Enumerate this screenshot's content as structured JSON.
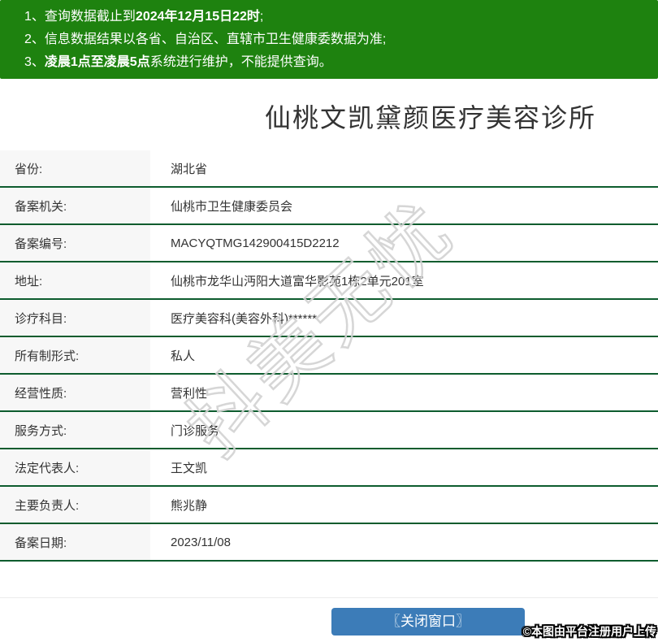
{
  "colors": {
    "banner_green": "#1e820f",
    "divider_green": "#0d5c2e",
    "button_blue": "#3c7cb8",
    "label_background": "#f7f7f7"
  },
  "banner": {
    "notices": [
      {
        "num": "1、",
        "pre": "查询数据截止到",
        "bold": "2024年12月15日22时",
        "post": ";"
      },
      {
        "num": "2、",
        "pre": "信息数据结果以各省、自治区、直辖市卫生健康委数据为准;",
        "bold": "",
        "post": ""
      },
      {
        "num": "3、",
        "pre": "",
        "bold": "凌晨1点至凌晨5点",
        "post": "系统进行维护，不能提供查询。"
      }
    ]
  },
  "title": "仙桃文凯黛颜医疗美容诊所",
  "record_table": {
    "rows": [
      {
        "label": "省份:",
        "value": "湖北省"
      },
      {
        "label": "备案机关:",
        "value": "仙桃市卫生健康委员会"
      },
      {
        "label": "备案编号:",
        "value": "MACYQTMG142900415D2212"
      },
      {
        "label": "地址:",
        "value": "仙桃市龙华山沔阳大道富华影苑1栋2单元201室"
      },
      {
        "label": "诊疗科目:",
        "value": "医疗美容科(美容外科)******"
      },
      {
        "label": "所有制形式:",
        "value": "私人"
      },
      {
        "label": "经营性质:",
        "value": "营利性"
      },
      {
        "label": "服务方式:",
        "value": "门诊服务"
      },
      {
        "label": "法定代表人:",
        "value": "王文凯"
      },
      {
        "label": "主要负责人:",
        "value": "熊兆静"
      },
      {
        "label": "备案日期:",
        "value": "2023/11/08"
      }
    ]
  },
  "watermark": "抖美无忧",
  "footer": {
    "close_button_label": "〖关闭窗口〗",
    "stamp": "©本图由平台注册用户上传"
  }
}
